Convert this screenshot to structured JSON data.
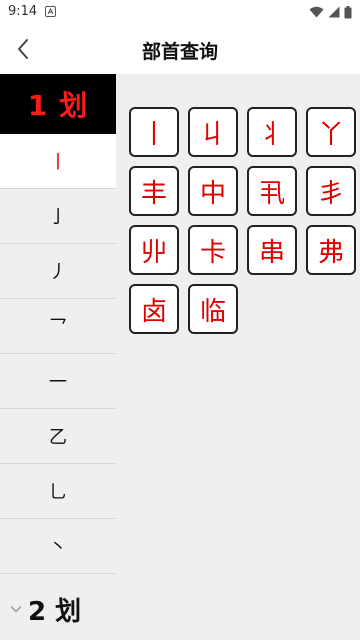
{
  "status_bar": {
    "time": "9:14",
    "icons": [
      "notification-a-icon",
      "wifi-icon",
      "signal-icon",
      "battery-icon"
    ]
  },
  "header": {
    "title": "部首查询",
    "back_icon": "chevron-left-icon"
  },
  "stroke_list": {
    "group_label": "1 划",
    "items": [
      "丨",
      "亅",
      "丿",
      "乛",
      "一",
      "乙",
      "乚",
      "丶"
    ],
    "selected_index": 0,
    "next_group_label": "2 划"
  },
  "radicals": [
    "丨",
    "丩",
    "丬",
    "丫",
    "丰",
    "中",
    "丮",
    "丯",
    "丱",
    "卡",
    "串",
    "弗",
    "卤",
    "临"
  ],
  "colors": {
    "accent_red": "#e00000",
    "header_black": "#000000",
    "panel_gray": "#efefef"
  }
}
